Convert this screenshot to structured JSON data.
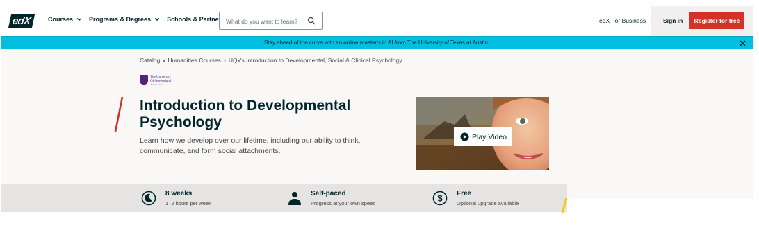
{
  "header": {
    "logo_text": "edX",
    "nav": [
      {
        "label": "Courses",
        "has_dropdown": true
      },
      {
        "label": "Programs & Degrees",
        "has_dropdown": true
      },
      {
        "label": "Schools & Partners",
        "has_dropdown": false
      }
    ],
    "search": {
      "placeholder": "What do you want to learn?",
      "value": "",
      "icon": "search-icon"
    },
    "business_link": "edX For Business",
    "signin_label": "Sign in",
    "register_label": "Register for free"
  },
  "banner": {
    "text": "Stay ahead of the curve with an online master's in AI from The University of Texas at Austin.",
    "close_icon": "close-icon"
  },
  "breadcrumb": [
    "Catalog",
    "Humanities Courses",
    "UQx's Introduction to Developmental, Social & Clinical Psychology"
  ],
  "partner": {
    "line1": "The University",
    "line2": "Of Queensland",
    "line3": "Australia"
  },
  "course": {
    "title": "Introduction to Developmental Psychology",
    "description": "Learn how we develop over our lifetime, including our ability to think, communicate, and form social attachments.",
    "play_label": "Play Video"
  },
  "stats": [
    {
      "icon": "moon-clock-icon",
      "title": "8 weeks",
      "subtitle": "1–2 hours per week"
    },
    {
      "icon": "person-icon",
      "title": "Self-paced",
      "subtitle": "Progress at your own speed"
    },
    {
      "icon": "dollar-icon",
      "title": "Free",
      "subtitle": "Optional upgrade available"
    }
  ],
  "colors": {
    "brand_dark": "#00262b",
    "register_red": "#d23228",
    "banner_cyan": "#00bfe0",
    "accent_yellow": "#f0cc00"
  }
}
